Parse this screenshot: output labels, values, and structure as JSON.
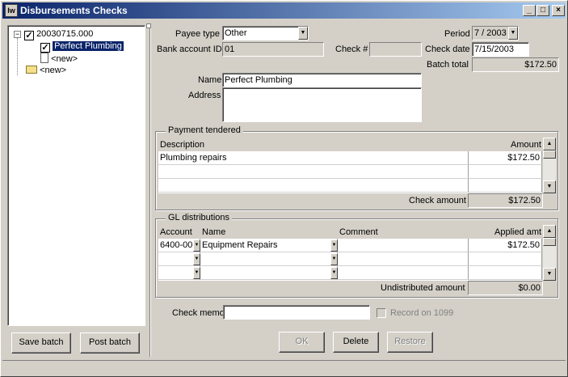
{
  "window": {
    "title": "Disbursements Checks",
    "app_icon_text": "Iw"
  },
  "tree": {
    "batch_label": "20030715.000",
    "check_label": "Perfect Plumbing",
    "new_check_label": "<new>",
    "new_batch_label": "<new>"
  },
  "left_buttons": {
    "save_batch": "Save batch",
    "post_batch": "Post batch"
  },
  "header": {
    "payee_type_label": "Payee type",
    "payee_type_value": "Other",
    "bank_account_label": "Bank account ID",
    "bank_account_value": "01",
    "check_no_label": "Check #",
    "check_no_value": "",
    "period_label": "Period",
    "period_value": "7 / 2003",
    "check_date_label": "Check date",
    "check_date_value": "7/15/2003",
    "batch_total_label": "Batch total",
    "batch_total_value": "$172.50",
    "name_label": "Name",
    "name_value": "Perfect Plumbing",
    "address_label": "Address",
    "address_value": ""
  },
  "payment": {
    "group_label": "Payment tendered",
    "col_description": "Description",
    "col_amount": "Amount",
    "rows": [
      {
        "description": "Plumbing repairs",
        "amount": "$172.50"
      },
      {
        "description": "",
        "amount": ""
      },
      {
        "description": "",
        "amount": ""
      }
    ],
    "check_amount_label": "Check amount",
    "check_amount_value": "$172.50"
  },
  "gl": {
    "group_label": "GL distributions",
    "col_account": "Account",
    "col_name": "Name",
    "col_comment": "Comment",
    "col_applied": "Applied amt",
    "rows": [
      {
        "account": "6400-00",
        "name": "Equipment Repairs",
        "comment": "",
        "applied": "$172.50"
      },
      {
        "account": "",
        "name": "",
        "comment": "",
        "applied": ""
      },
      {
        "account": "",
        "name": "",
        "comment": "",
        "applied": ""
      }
    ],
    "undistributed_label": "Undistributed amount",
    "undistributed_value": "$0.00"
  },
  "footer": {
    "check_memo_label": "Check memo",
    "check_memo_value": "",
    "record_1099_label": "Record on 1099",
    "ok_label": "OK",
    "delete_label": "Delete",
    "restore_label": "Restore"
  }
}
